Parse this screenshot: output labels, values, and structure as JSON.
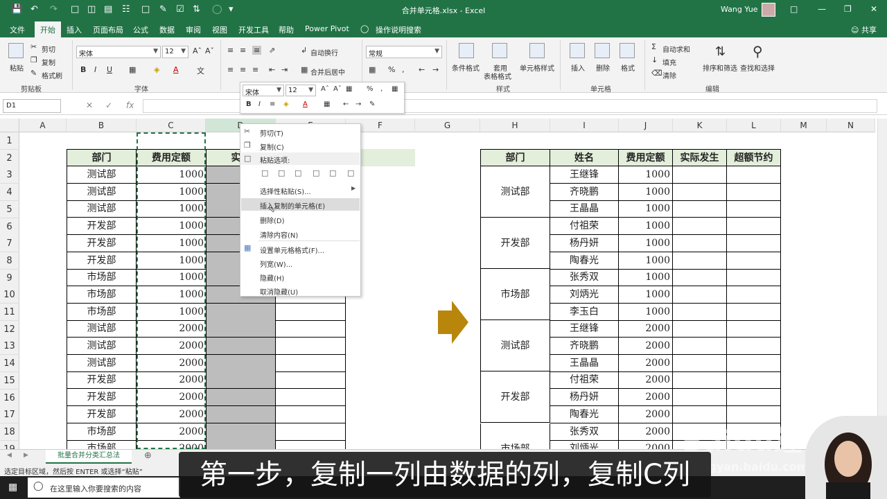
{
  "window": {
    "title": "合并单元格.xlsx - Excel",
    "user": "Wang Yue"
  },
  "tabs": [
    "文件",
    "开始",
    "插入",
    "页面布局",
    "公式",
    "数据",
    "审阅",
    "视图",
    "开发工具",
    "帮助",
    "Power Pivot"
  ],
  "tell_me": "操作说明搜索",
  "share": "共享",
  "ribbon": {
    "clipboard": {
      "paste": "粘贴",
      "cut": "剪切",
      "copy": "复制",
      "format_painter": "格式刷",
      "group": "剪贴板"
    },
    "font": {
      "name": "宋体",
      "size": "12",
      "group": "字体"
    },
    "alignment": {
      "wrap": "自动换行",
      "merge": "合并后居中"
    },
    "number": {
      "format": "常规"
    },
    "styles": {
      "conditional": "条件格式",
      "table1": "套用",
      "table2": "表格格式",
      "cell_styles": "单元格样式",
      "group": "样式"
    },
    "cells": {
      "insert": "插入",
      "delete": "删除",
      "format": "格式",
      "group": "单元格"
    },
    "editing": {
      "autosum": "自动求和",
      "fill": "填充",
      "clear": "清除",
      "sort": "排序和筛选",
      "find": "查找和选择",
      "group": "编辑"
    }
  },
  "formula_bar": {
    "name_box": "D1",
    "fx": "fx"
  },
  "columns": [
    "A",
    "B",
    "C",
    "D",
    "E",
    "F",
    "G",
    "H",
    "I",
    "J",
    "K",
    "L",
    "M",
    "N"
  ],
  "rows": [
    "1",
    "2",
    "3",
    "4",
    "5",
    "6",
    "7",
    "8",
    "9",
    "10",
    "11",
    "12",
    "13",
    "14",
    "15",
    "16",
    "17",
    "18",
    "19"
  ],
  "left_table": {
    "headers": [
      "部门",
      "费用定额",
      "实际"
    ],
    "rows": [
      [
        "测试部",
        "1000"
      ],
      [
        "测试部",
        "1000"
      ],
      [
        "测试部",
        "1000"
      ],
      [
        "开发部",
        "1000"
      ],
      [
        "开发部",
        "1000"
      ],
      [
        "开发部",
        "1000"
      ],
      [
        "市场部",
        "1000"
      ],
      [
        "市场部",
        "1000"
      ],
      [
        "市场部",
        "1000"
      ],
      [
        "测试部",
        "2000"
      ],
      [
        "测试部",
        "2000"
      ],
      [
        "测试部",
        "2000"
      ],
      [
        "开发部",
        "2000"
      ],
      [
        "开发部",
        "2000"
      ],
      [
        "开发部",
        "2000"
      ],
      [
        "市场部",
        "2000"
      ],
      [
        "市场部",
        "2000"
      ]
    ]
  },
  "right_table": {
    "headers": [
      "部门",
      "姓名",
      "费用定额",
      "实际发生",
      "超额节约"
    ],
    "groups": [
      "测试部",
      "开发部",
      "市场部",
      "测试部",
      "开发部",
      "市场部"
    ],
    "names": [
      "王继锋",
      "齐晓鹏",
      "王晶晶",
      "付祖荣",
      "杨丹妍",
      "陶春光",
      "张秀双",
      "刘炳光",
      "李玉白",
      "王继锋",
      "齐晓鹏",
      "王晶晶",
      "付祖荣",
      "杨丹妍",
      "陶春光",
      "张秀双",
      "刘炳光"
    ],
    "amounts": [
      "1000",
      "1000",
      "1000",
      "1000",
      "1000",
      "1000",
      "1000",
      "1000",
      "1000",
      "2000",
      "2000",
      "2000",
      "2000",
      "2000",
      "2000",
      "2000",
      "2000"
    ]
  },
  "mini_toolbar": {
    "font": "宋体",
    "size": "12"
  },
  "context_menu": {
    "cut": "剪切(T)",
    "copy": "复制(C)",
    "paste_options": "粘贴选项:",
    "paste_special": "选择性粘贴(S)...",
    "insert_copied": "插入复制的单元格(E)",
    "delete": "删除(D)",
    "clear": "清除内容(N)",
    "format_cells": "设置单元格格式(F)...",
    "col_width": "列宽(W)...",
    "hide": "隐藏(H)",
    "unhide": "取消隐藏(U)"
  },
  "sheet_tab": "批量合并分类汇总法",
  "status": "选定目标区域，然后按 ENTER 或选择“粘贴”",
  "taskbar": {
    "search": "在这里输入你要搜索的内容"
  },
  "subtitle": "第一步，复制一列由数据的列，复制C列",
  "watermark": {
    "brand": "Baidu经验",
    "url": "jingyan.baidu.com"
  }
}
